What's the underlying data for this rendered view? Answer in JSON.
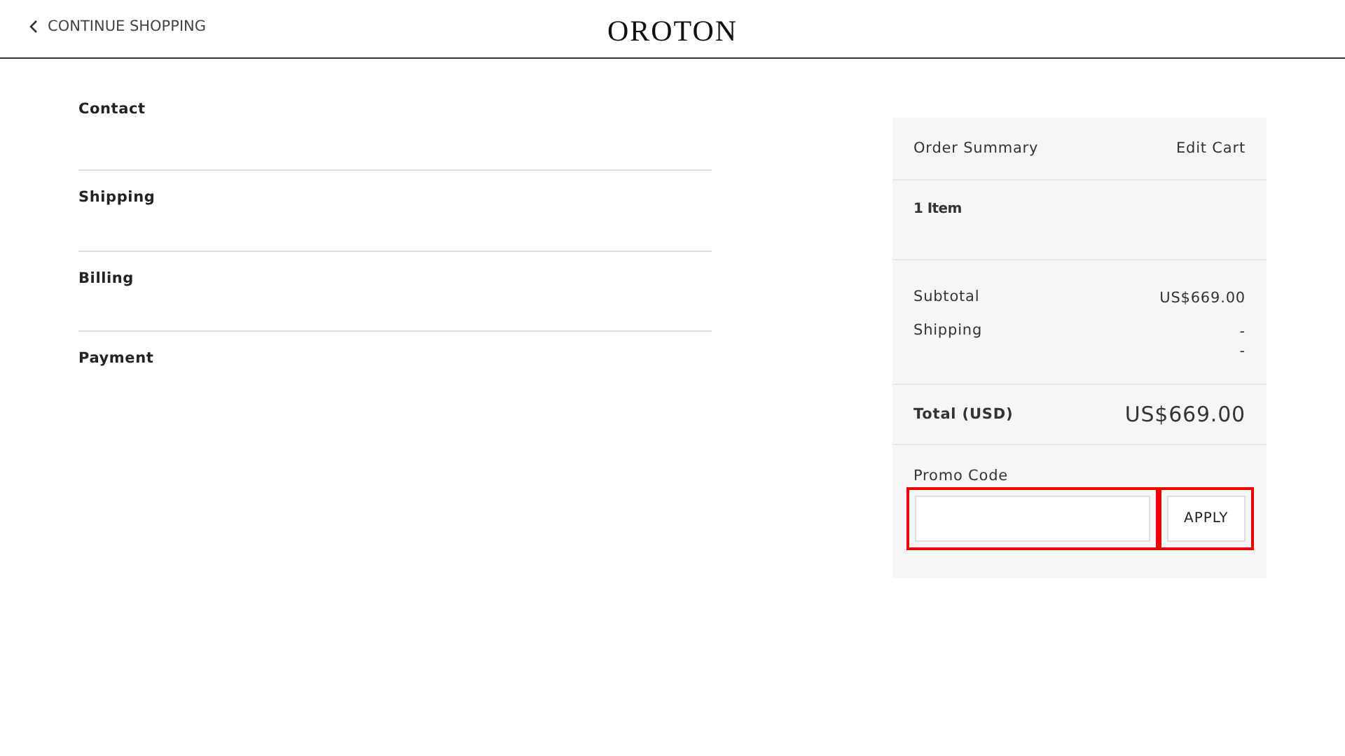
{
  "header": {
    "back_link": "CONTINUE SHOPPING",
    "logo": "OROTON"
  },
  "steps": [
    {
      "label": "Contact"
    },
    {
      "label": "Shipping"
    },
    {
      "label": "Billing"
    },
    {
      "label": "Payment"
    }
  ],
  "summary": {
    "title": "Order Summary",
    "edit_link": "Edit Cart",
    "item_count": "1 Item",
    "lines": [
      {
        "label": "Subtotal",
        "values": [
          "US$669.00"
        ]
      },
      {
        "label": "Shipping",
        "values": [
          "-",
          "-"
        ]
      }
    ],
    "total_label": "Total (USD)",
    "total_value": "US$669.00",
    "promo": {
      "label": "Promo Code",
      "highlighted": true
    },
    "apply_button": {
      "label": "APPLY",
      "highlighted": true
    }
  }
}
